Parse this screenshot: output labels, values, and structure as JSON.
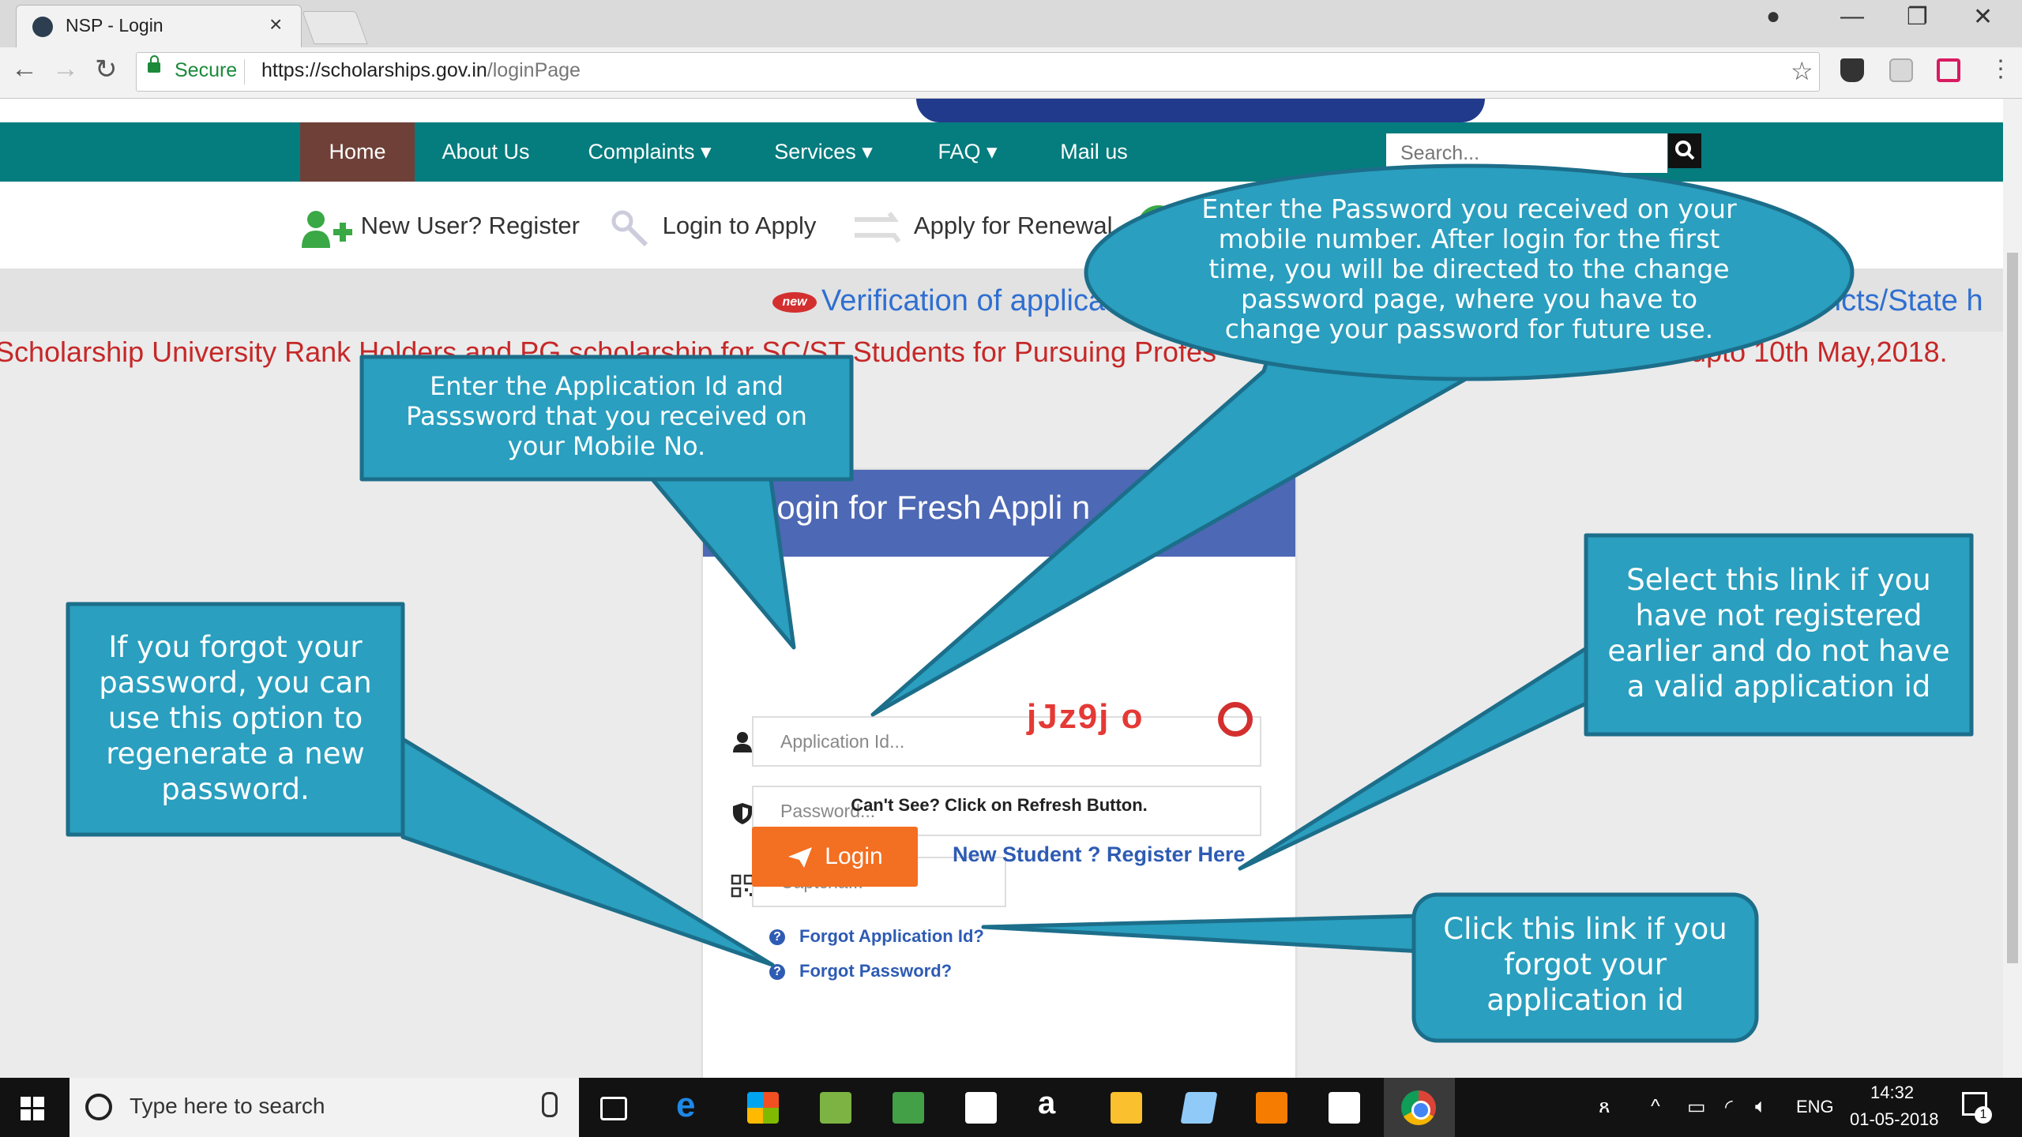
{
  "browser": {
    "tab_title": "NSP - Login",
    "secure_label": "Secure",
    "url_host": "https://scholarships.gov.in",
    "url_path": "/loginPage"
  },
  "nav": {
    "items": [
      "Home",
      "About Us",
      "Complaints ▾",
      "Services ▾",
      "FAQ ▾",
      "Mail us"
    ],
    "search_placeholder": "Search..."
  },
  "quickbar": {
    "register": "New User? Register",
    "login_apply": "Login to Apply",
    "renewal": "Apply for Renewal"
  },
  "marquee": {
    "badge": "new",
    "line1_left": "Verification of applica",
    "line1_right": "ricts/State h",
    "line2_left": "Scholarship University Rank Holders and PG scholarship for SC/ST Students for Pursuing Profes",
    "line2_right": "nded upto 10th May,2018."
  },
  "login": {
    "title": "Login for Fresh Appli          n",
    "app_id_placeholder": "Application Id...",
    "password_placeholder": "Password...",
    "captcha_placeholder": "Captcha...",
    "captcha_text": "jJz9j o",
    "cant_see": "Can't See? Click on Refresh Button.",
    "login_button": "Login",
    "register_link": "New Student ? Register Here",
    "forgot_app_id": "Forgot Application Id?",
    "forgot_password": "Forgot Password?"
  },
  "callouts": {
    "password_info": [
      "Enter the Password you received on your",
      "mobile number. After login for the first",
      "time, you will be directed to the change",
      "password page, where you have to",
      "change your password for future use."
    ],
    "appid_info": [
      "Enter the  Application Id and",
      "Passsword that you received on",
      "your  Mobile No."
    ],
    "register_info": [
      "Select this link if you",
      "have not registered",
      "earlier and do not have",
      "a valid application id"
    ],
    "forgot_pw_info": [
      "If you forgot your",
      "password, you can",
      "use this option to",
      "regenerate a new",
      "password."
    ],
    "forgot_id_info": [
      "Click this link if you",
      "forgot your",
      "application id"
    ]
  },
  "taskbar": {
    "search_placeholder": "Type here to search",
    "language": "ENG",
    "time": "14:32",
    "date": "01-05-2018",
    "notification_count": "1"
  },
  "colors": {
    "nav_bg": "#057c7e",
    "nav_active": "#6f4037",
    "login_header": "#4d68b4",
    "login_button": "#f36f21",
    "callout_fill": "#2a9fbf",
    "callout_stroke": "#1c6e8a"
  }
}
